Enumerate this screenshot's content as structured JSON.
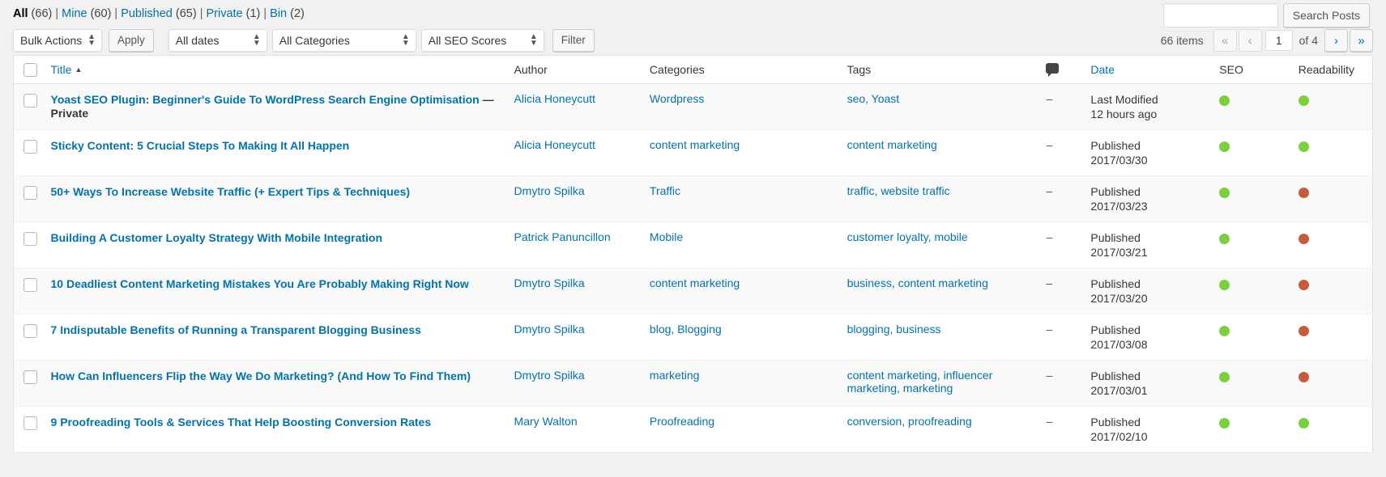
{
  "views": {
    "items": [
      {
        "label": "All",
        "count": "(66)",
        "current": true
      },
      {
        "label": "Mine",
        "count": "(60)",
        "current": false
      },
      {
        "label": "Published",
        "count": "(65)",
        "current": false
      },
      {
        "label": "Private",
        "count": "(1)",
        "current": false
      },
      {
        "label": "Bin",
        "count": "(2)",
        "current": false
      }
    ],
    "separator": "|"
  },
  "search": {
    "value": "",
    "placeholder": "",
    "button_label": "Search Posts"
  },
  "toolbar": {
    "bulk_actions_label": "Bulk Actions",
    "apply_label": "Apply",
    "dates_label": "All dates",
    "categories_label": "All Categories",
    "seo_scores_label": "All SEO Scores",
    "filter_label": "Filter"
  },
  "pagination": {
    "items_text": "66 items",
    "first_label": "«",
    "prev_label": "‹",
    "current_page": "1",
    "total_text": "of 4",
    "next_label": "›",
    "last_label": "»"
  },
  "table": {
    "columns": {
      "title": "Title",
      "author": "Author",
      "categories": "Categories",
      "tags": "Tags",
      "comments": "comment-icon",
      "date": "Date",
      "seo": "SEO",
      "readability": "Readability"
    },
    "sort_arrow": "▲",
    "rows": [
      {
        "title": "Yoast SEO Plugin: Beginner's Guide To WordPress Search Engine Optimisation",
        "state": "— Private",
        "author": "Alicia Honeycutt",
        "categories": "Wordpress",
        "tags": "seo, Yoast",
        "comments": "–",
        "date_status": "Last Modified",
        "date_value": "12 hours ago",
        "seo": "good",
        "readability": "good"
      },
      {
        "title": "Sticky Content: 5 Crucial Steps To Making It All Happen",
        "state": "",
        "author": "Alicia Honeycutt",
        "categories": "content marketing",
        "tags": "content marketing",
        "comments": "–",
        "date_status": "Published",
        "date_value": "2017/03/30",
        "seo": "good",
        "readability": "good"
      },
      {
        "title": "50+ Ways To Increase Website Traffic (+ Expert Tips & Techniques)",
        "state": "",
        "author": "Dmytro Spilka",
        "categories": "Traffic",
        "tags": "traffic, website traffic",
        "comments": "–",
        "date_status": "Published",
        "date_value": "2017/03/23",
        "seo": "good",
        "readability": "bad"
      },
      {
        "title": "Building A Customer Loyalty Strategy With Mobile Integration",
        "state": "",
        "author": "Patrick Panuncillon",
        "categories": "Mobile",
        "tags": "customer loyalty, mobile",
        "comments": "–",
        "date_status": "Published",
        "date_value": "2017/03/21",
        "seo": "good",
        "readability": "bad"
      },
      {
        "title": "10 Deadliest Content Marketing Mistakes You Are Probably Making Right Now",
        "state": "",
        "author": "Dmytro Spilka",
        "categories": "content marketing",
        "tags": "business, content marketing",
        "comments": "–",
        "date_status": "Published",
        "date_value": "2017/03/20",
        "seo": "good",
        "readability": "bad"
      },
      {
        "title": "7 Indisputable Benefits of Running a Transparent Blogging Business",
        "state": "",
        "author": "Dmytro Spilka",
        "categories": "blog, Blogging",
        "tags": "blogging, business",
        "comments": "–",
        "date_status": "Published",
        "date_value": "2017/03/08",
        "seo": "good",
        "readability": "bad"
      },
      {
        "title": "How Can Influencers Flip the Way We Do Marketing? (And How To Find Them)",
        "state": "",
        "author": "Dmytro Spilka",
        "categories": "marketing",
        "tags": "content marketing, influencer marketing, marketing",
        "comments": "–",
        "date_status": "Published",
        "date_value": "2017/03/01",
        "seo": "good",
        "readability": "bad"
      },
      {
        "title": "9 Proofreading Tools & Services That Help Boosting Conversion Rates",
        "state": "",
        "author": "Mary Walton",
        "categories": "Proofreading",
        "tags": "conversion, proofreading",
        "comments": "–",
        "date_status": "Published",
        "date_value": "2017/02/10",
        "seo": "good",
        "readability": "good"
      }
    ]
  },
  "colors": {
    "link": "#0073aa",
    "dot_good": "#7ad03a",
    "dot_bad": "#c75c3c"
  }
}
